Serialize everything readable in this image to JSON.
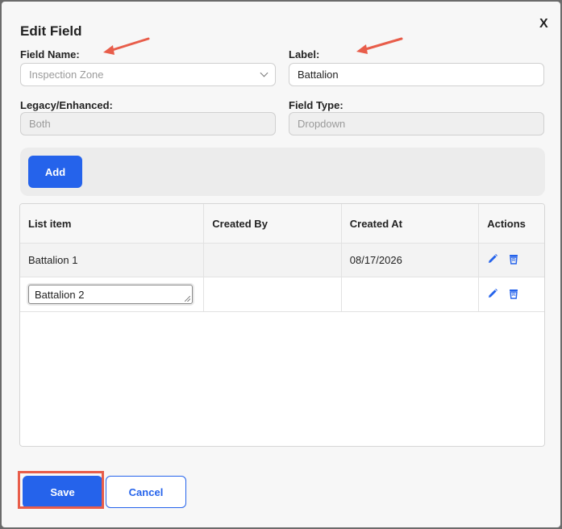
{
  "dialog": {
    "title": "Edit Field",
    "close_label": "X"
  },
  "form": {
    "field_name_label": "Field Name:",
    "field_name_value": "Inspection Zone",
    "label_label": "Label:",
    "label_value": "Battalion",
    "legacy_label": "Legacy/Enhanced:",
    "legacy_value": "Both",
    "field_type_label": "Field Type:",
    "field_type_value": "Dropdown"
  },
  "add_button_label": "Add",
  "table": {
    "columns": [
      "List item",
      "Created By",
      "Created At",
      "Actions"
    ],
    "rows": [
      {
        "item": "Battalion 1",
        "created_by": "",
        "created_at": "08/17/2026"
      },
      {
        "item": "Battalion 2",
        "created_by": "",
        "created_at": ""
      }
    ]
  },
  "footer": {
    "save_label": "Save",
    "cancel_label": "Cancel"
  },
  "colors": {
    "primary": "#2563eb",
    "annotation": "#e85d4a"
  },
  "icons": [
    "pencil-icon",
    "trash-icon",
    "chevron-down-icon",
    "close-icon",
    "arrow-annotation"
  ]
}
